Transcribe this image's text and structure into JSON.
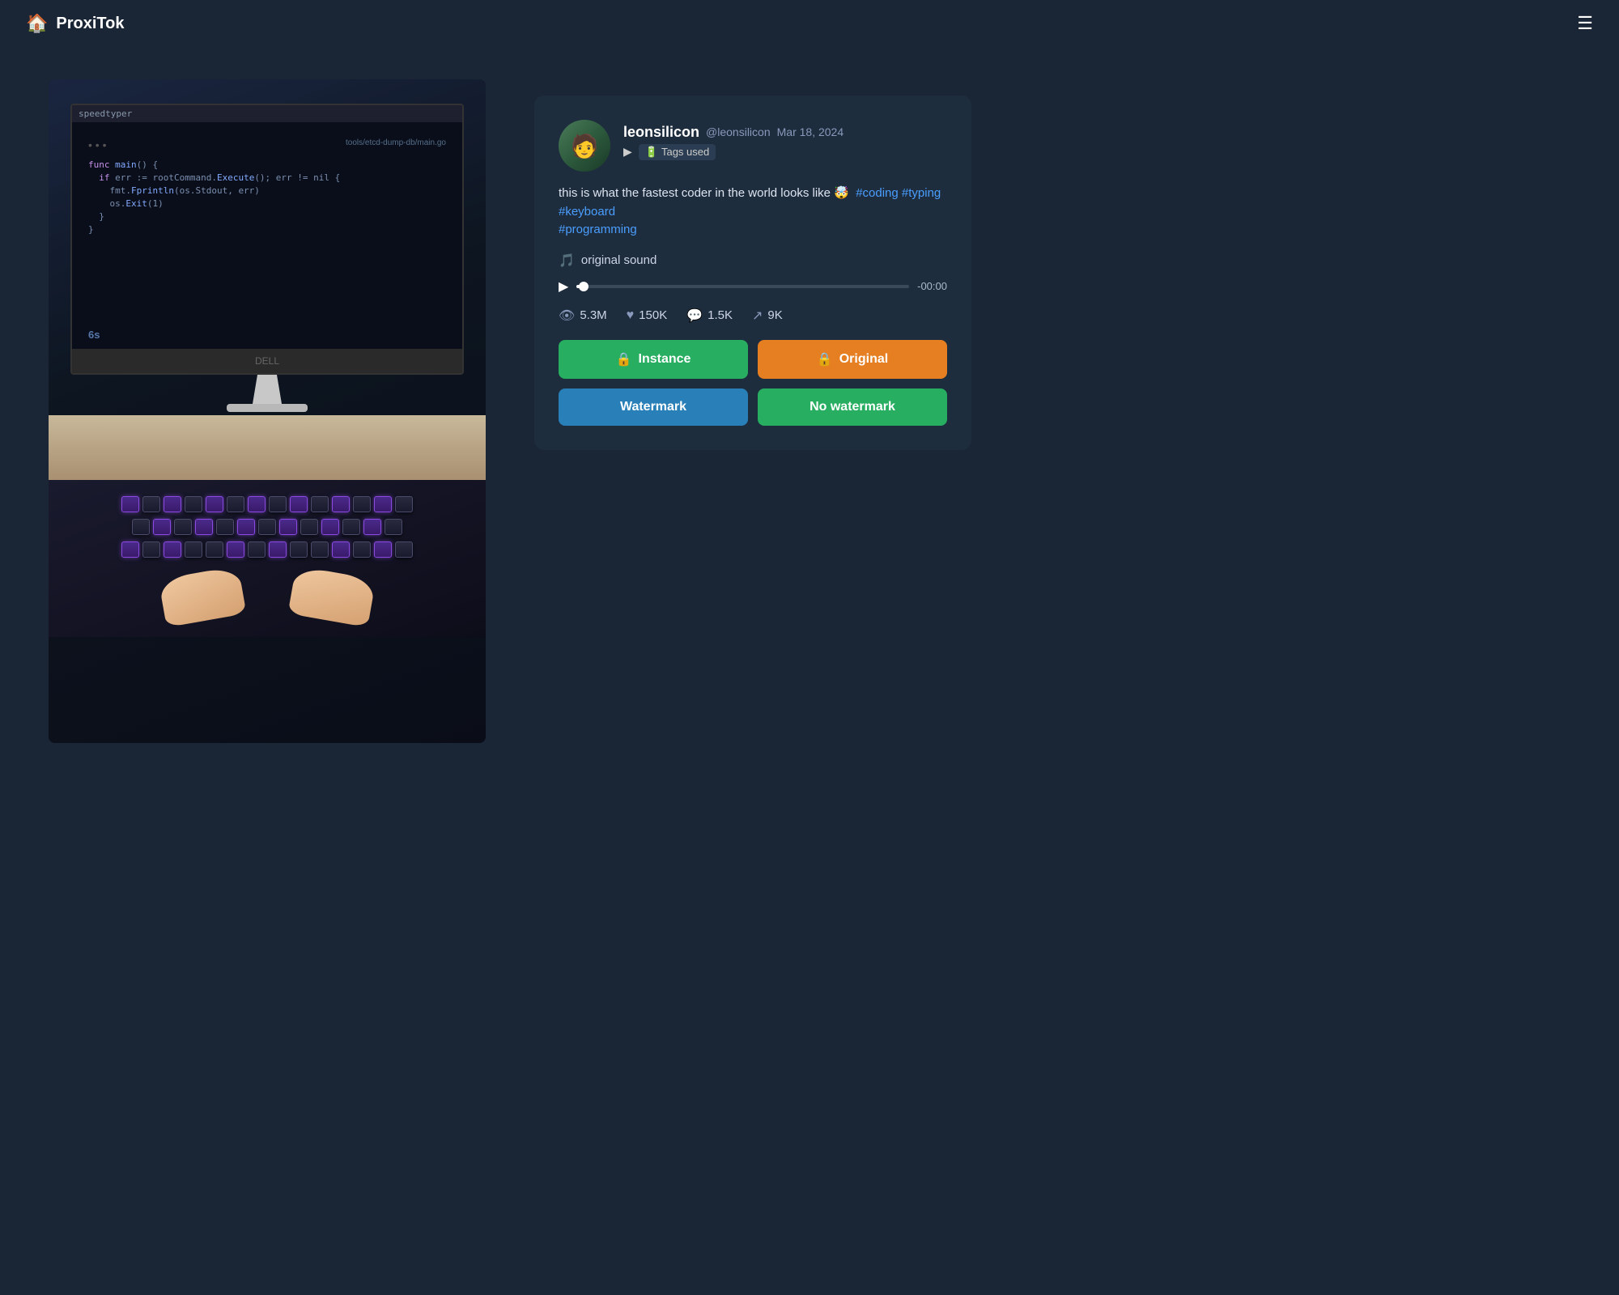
{
  "app": {
    "name": "ProxiTok",
    "logo_icon": "🏠"
  },
  "header": {
    "menu_icon": "☰"
  },
  "video": {
    "timer": "6s",
    "code_path": "tools/etcd-dump-db/main.go",
    "code_lines": [
      "...",
      "func main() {",
      "    if err := rootCommand.Execute(); err != nil {",
      "        fmt.Fprintln(os.Stdout, err)",
      "        os.Exit(1)",
      "    }",
      "}"
    ],
    "monitor_brand": "DELL",
    "title_bar_text": "speedtyper"
  },
  "post": {
    "username": "leonsilicon",
    "handle": "@leonsilicon",
    "date": "Mar 18, 2024",
    "play_label": "▶",
    "tags_label": "Tags used",
    "description": "this is what the fastest coder in the world looks like 🤯",
    "hashtags": [
      "#coding",
      "#typing",
      "#keyboard",
      "#programming"
    ],
    "sound_label": "original sound",
    "time_current": "-00:00",
    "stats": {
      "views": "5.3M",
      "likes": "150K",
      "comments": "1.5K",
      "shares": "9K"
    },
    "buttons": {
      "instance": "Instance",
      "original": "Original",
      "watermark": "Watermark",
      "no_watermark": "No watermark"
    }
  }
}
